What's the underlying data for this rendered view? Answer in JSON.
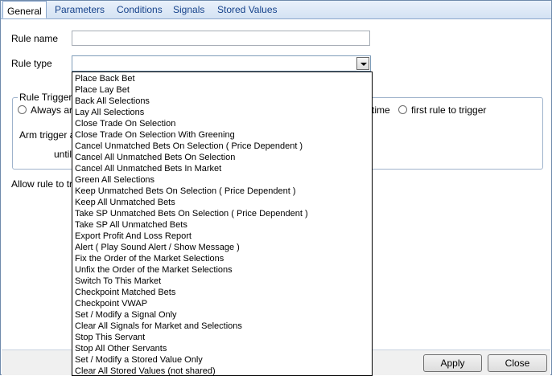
{
  "tabs": [
    {
      "label": "General"
    },
    {
      "label": "Parameters"
    },
    {
      "label": "Conditions"
    },
    {
      "label": "Signals"
    },
    {
      "label": "Stored Values"
    }
  ],
  "form": {
    "rule_name_label": "Rule name",
    "rule_name_value": "",
    "rule_type_label": "Rule type",
    "rule_type_value": ""
  },
  "trigger_group": {
    "legend": "Rule Trigger",
    "option_always": "Always ar",
    "option_time": "time",
    "option_first_rule": "first rule to trigger",
    "arm_trigger_label": "Arm trigger at",
    "until_label": "until"
  },
  "allow_rule_label": "Allow rule to tri",
  "dropdown_options": [
    "Place Back Bet",
    "Place Lay Bet",
    "Back All Selections",
    "Lay All Selections",
    "Close Trade On Selection",
    "Close Trade On Selection With Greening",
    "Cancel Unmatched Bets On Selection ( Price Dependent )",
    "Cancel All Unmatched Bets On Selection",
    "Cancel All Unmatched Bets In Market",
    "Green All Selections",
    "Keep Unmatched Bets On Selection ( Price Dependent )",
    "Keep All Unmatched Bets",
    "Take SP Unmatched Bets On Selection ( Price Dependent )",
    "Take SP All Unmatched Bets",
    "Export Profit And Loss Report",
    "Alert ( Play Sound Alert / Show Message )",
    "Fix the Order of the Market Selections",
    "Unfix the Order of the Market Selections",
    "Switch To This Market",
    "Checkpoint Matched Bets",
    "Checkpoint VWAP",
    "Set / Modify a Signal Only",
    "Clear All Signals for Market and Selections",
    "Stop This Servant",
    "Stop All Other Servants",
    "Set / Modify a Stored Value Only",
    "Clear All Stored Values (not shared)"
  ],
  "buttons": {
    "apply": "Apply",
    "close": "Close"
  }
}
